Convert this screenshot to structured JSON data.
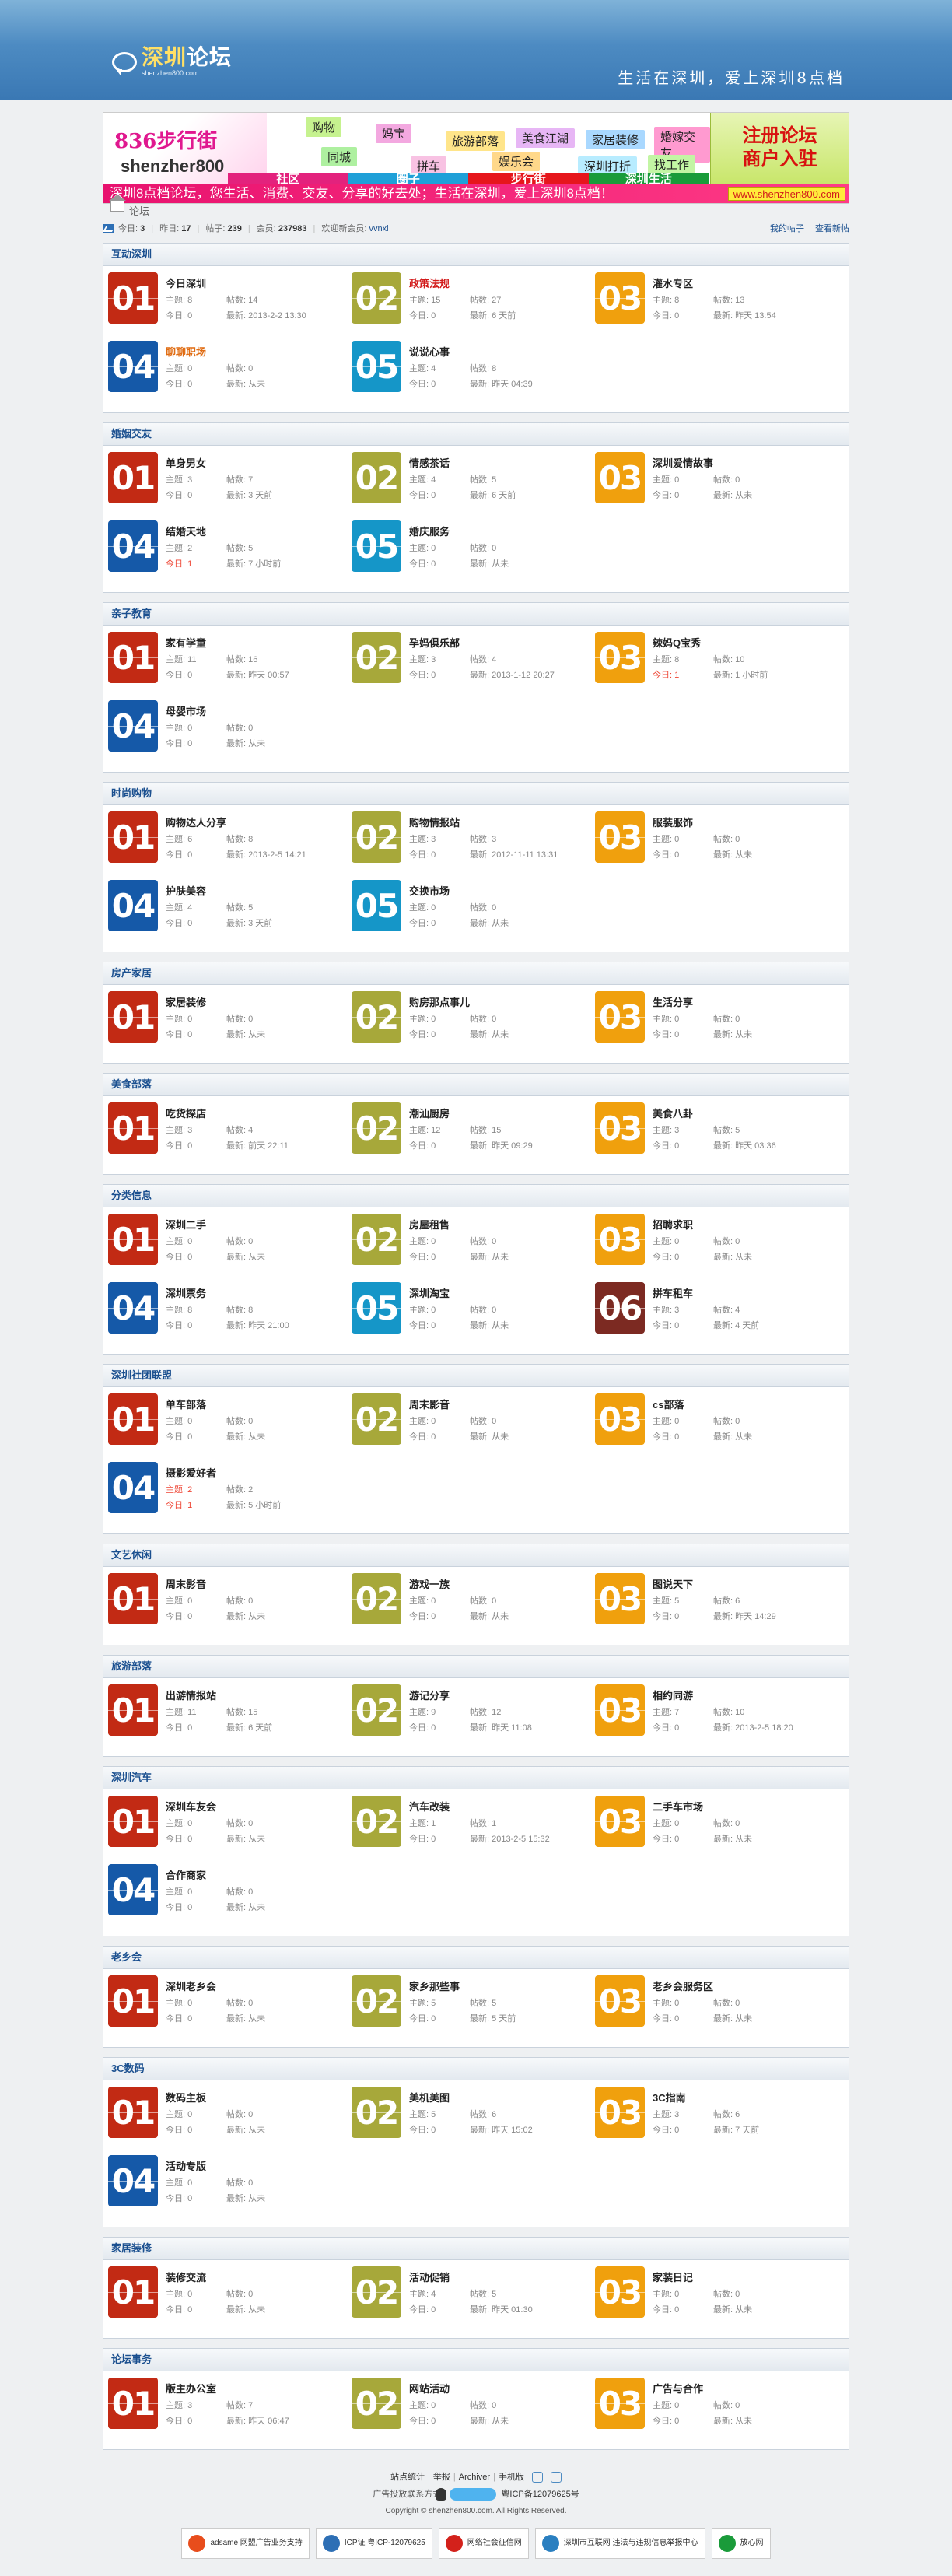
{
  "header": {
    "logo_title_a": "深圳",
    "logo_title_b": "论坛",
    "logo_url": "shenzhen800.com",
    "slogan": "生活在深圳，爱上深圳8点档"
  },
  "banner": {
    "logo_a": "836步行街",
    "logo_b": "shenzher800",
    "tags": [
      "购物",
      "妈宝",
      "旅游部落",
      "美食江湖",
      "家居装修",
      "婚嫁交友",
      "租房",
      "同城",
      "拼车",
      "娱乐会",
      "深圳打折",
      "找工作"
    ],
    "bar": [
      "社区",
      "圈子",
      "步行街",
      "深圳生活"
    ],
    "register": "注册论坛",
    "merchant": "商户入驻",
    "scroll": "深圳8点档论坛，您生活、消费、交友、分享的好去处；生活在深圳，爱上深圳8点档！",
    "url": "www.shenzhen800.com"
  },
  "crumb": "论坛",
  "stats": {
    "today_label": "今日:",
    "today": "3",
    "yesterday_label": "昨日:",
    "yesterday": "17",
    "posts_label": "帖子:",
    "posts": "239",
    "members_label": "会员:",
    "members": "237983",
    "welcome_label": "欢迎新会员:",
    "welcome": "vvnxi",
    "my_posts": "我的帖子",
    "new_posts": "查看新帖"
  },
  "sections": [
    {
      "title": "互动深圳",
      "forums": [
        {
          "num": "01",
          "name": "今日深圳",
          "s": "8",
          "p": "14",
          "t": "0",
          "l": "2013-2-2 13:30"
        },
        {
          "num": "02",
          "name": "政策法规",
          "s": "15",
          "p": "27",
          "t": "0",
          "l": "6 天前",
          "hot": 1
        },
        {
          "num": "03",
          "name": "灌水专区",
          "s": "8",
          "p": "13",
          "t": "0",
          "l": "昨天 13:54"
        },
        {
          "num": "04",
          "name": "聊聊职场",
          "s": "0",
          "p": "0",
          "t": "0",
          "l": "从未",
          "hot": 2
        },
        {
          "num": "05",
          "name": "说说心事",
          "s": "4",
          "p": "8",
          "t": "0",
          "l": "昨天 04:39"
        }
      ]
    },
    {
      "title": "婚姻交友",
      "forums": [
        {
          "num": "01",
          "name": "单身男女",
          "s": "3",
          "p": "7",
          "t": "0",
          "l": "3 天前"
        },
        {
          "num": "02",
          "name": "情感茶话",
          "s": "4",
          "p": "5",
          "t": "0",
          "l": "6 天前"
        },
        {
          "num": "03",
          "name": "深圳爱情故事",
          "s": "0",
          "p": "0",
          "t": "0",
          "l": "从未"
        },
        {
          "num": "04",
          "name": "结婚天地",
          "s": "2",
          "p": "5",
          "t": "1",
          "l": "7 小时前",
          "tr": 1
        },
        {
          "num": "05",
          "name": "婚庆服务",
          "s": "0",
          "p": "0",
          "t": "0",
          "l": "从未"
        }
      ]
    },
    {
      "title": "亲子教育",
      "forums": [
        {
          "num": "01",
          "name": "家有学童",
          "s": "11",
          "p": "16",
          "t": "0",
          "l": "昨天 00:57"
        },
        {
          "num": "02",
          "name": "孕妈俱乐部",
          "s": "3",
          "p": "4",
          "t": "0",
          "l": "2013-1-12 20:27"
        },
        {
          "num": "03",
          "name": "辣妈Q宝秀",
          "s": "8",
          "p": "10",
          "t": "1",
          "l": "1 小时前",
          "tr": 1
        },
        {
          "num": "04",
          "name": "母婴市场",
          "s": "0",
          "p": "0",
          "t": "0",
          "l": "从未"
        }
      ]
    },
    {
      "title": "时尚购物",
      "forums": [
        {
          "num": "01",
          "name": "购物达人分享",
          "s": "6",
          "p": "8",
          "t": "0",
          "l": "2013-2-5 14:21"
        },
        {
          "num": "02",
          "name": "购物情报站",
          "s": "3",
          "p": "3",
          "t": "0",
          "l": "2012-11-11 13:31"
        },
        {
          "num": "03",
          "name": "服装服饰",
          "s": "0",
          "p": "0",
          "t": "0",
          "l": "从未"
        },
        {
          "num": "04",
          "name": "护肤美容",
          "s": "4",
          "p": "5",
          "t": "0",
          "l": "3 天前"
        },
        {
          "num": "05",
          "name": "交换市场",
          "s": "0",
          "p": "0",
          "t": "0",
          "l": "从未"
        }
      ]
    },
    {
      "title": "房产家居",
      "forums": [
        {
          "num": "01",
          "name": "家居装修",
          "s": "0",
          "p": "0",
          "t": "0",
          "l": "从未"
        },
        {
          "num": "02",
          "name": "购房那点事儿",
          "s": "0",
          "p": "0",
          "t": "0",
          "l": "从未"
        },
        {
          "num": "03",
          "name": "生活分享",
          "s": "0",
          "p": "0",
          "t": "0",
          "l": "从未"
        }
      ]
    },
    {
      "title": "美食部落",
      "forums": [
        {
          "num": "01",
          "name": "吃货探店",
          "s": "3",
          "p": "4",
          "t": "0",
          "l": "前天 22:11"
        },
        {
          "num": "02",
          "name": "潮汕厨房",
          "s": "12",
          "p": "15",
          "t": "0",
          "l": "昨天 09:29"
        },
        {
          "num": "03",
          "name": "美食八卦",
          "s": "3",
          "p": "5",
          "t": "0",
          "l": "昨天 03:36"
        }
      ]
    },
    {
      "title": "分类信息",
      "forums": [
        {
          "num": "01",
          "name": "深圳二手",
          "s": "0",
          "p": "0",
          "t": "0",
          "l": "从未"
        },
        {
          "num": "02",
          "name": "房屋租售",
          "s": "0",
          "p": "0",
          "t": "0",
          "l": "从未"
        },
        {
          "num": "03",
          "name": "招聘求职",
          "s": "0",
          "p": "0",
          "t": "0",
          "l": "从未"
        },
        {
          "num": "04",
          "name": "深圳票务",
          "s": "8",
          "p": "8",
          "t": "0",
          "l": "昨天 21:00"
        },
        {
          "num": "05",
          "name": "深圳淘宝",
          "s": "0",
          "p": "0",
          "t": "0",
          "l": "从未"
        },
        {
          "num": "06",
          "name": "拼车租车",
          "s": "3",
          "p": "4",
          "t": "0",
          "l": "4 天前"
        }
      ]
    },
    {
      "title": "深圳社团联盟",
      "forums": [
        {
          "num": "01",
          "name": "单车部落",
          "s": "0",
          "p": "0",
          "t": "0",
          "l": "从未"
        },
        {
          "num": "02",
          "name": "周末影音",
          "s": "0",
          "p": "0",
          "t": "0",
          "l": "从未"
        },
        {
          "num": "03",
          "name": "cs部落",
          "s": "0",
          "p": "0",
          "t": "0",
          "l": "从未"
        },
        {
          "num": "04",
          "name": "摄影爱好者",
          "s": "2",
          "p": "2",
          "t": "1",
          "l": "5 小时前",
          "tr": 1,
          "sr": 1
        }
      ]
    },
    {
      "title": "文艺休闲",
      "forums": [
        {
          "num": "01",
          "name": "周末影音",
          "s": "0",
          "p": "0",
          "t": "0",
          "l": "从未"
        },
        {
          "num": "02",
          "name": "游戏一族",
          "s": "0",
          "p": "0",
          "t": "0",
          "l": "从未"
        },
        {
          "num": "03",
          "name": "图说天下",
          "s": "5",
          "p": "6",
          "t": "0",
          "l": "昨天 14:29"
        }
      ]
    },
    {
      "title": "旅游部落",
      "forums": [
        {
          "num": "01",
          "name": "出游情报站",
          "s": "11",
          "p": "15",
          "t": "0",
          "l": "6 天前"
        },
        {
          "num": "02",
          "name": "游记分享",
          "s": "9",
          "p": "12",
          "t": "0",
          "l": "昨天 11:08"
        },
        {
          "num": "03",
          "name": "相约同游",
          "s": "7",
          "p": "10",
          "t": "0",
          "l": "2013-2-5 18:20"
        }
      ]
    },
    {
      "title": "深圳汽车",
      "forums": [
        {
          "num": "01",
          "name": "深圳车友会",
          "s": "0",
          "p": "0",
          "t": "0",
          "l": "从未"
        },
        {
          "num": "02",
          "name": "汽车改装",
          "s": "1",
          "p": "1",
          "t": "0",
          "l": "2013-2-5 15:32"
        },
        {
          "num": "03",
          "name": "二手车市场",
          "s": "0",
          "p": "0",
          "t": "0",
          "l": "从未"
        },
        {
          "num": "04",
          "name": "合作商家",
          "s": "0",
          "p": "0",
          "t": "0",
          "l": "从未"
        }
      ]
    },
    {
      "title": "老乡会",
      "forums": [
        {
          "num": "01",
          "name": "深圳老乡会",
          "s": "0",
          "p": "0",
          "t": "0",
          "l": "从未"
        },
        {
          "num": "02",
          "name": "家乡那些事",
          "s": "5",
          "p": "5",
          "t": "0",
          "l": "5 天前"
        },
        {
          "num": "03",
          "name": "老乡会服务区",
          "s": "0",
          "p": "0",
          "t": "0",
          "l": "从未"
        }
      ]
    },
    {
      "title": "3C数码",
      "forums": [
        {
          "num": "01",
          "name": "数码主板",
          "s": "0",
          "p": "0",
          "t": "0",
          "l": "从未"
        },
        {
          "num": "02",
          "name": "美机美图",
          "s": "5",
          "p": "6",
          "t": "0",
          "l": "昨天 15:02"
        },
        {
          "num": "03",
          "name": "3C指南",
          "s": "3",
          "p": "6",
          "t": "0",
          "l": "7 天前"
        },
        {
          "num": "04",
          "name": "活动专版",
          "s": "0",
          "p": "0",
          "t": "0",
          "l": "从未"
        }
      ]
    },
    {
      "title": "家居装修",
      "forums": [
        {
          "num": "01",
          "name": "装修交流",
          "s": "0",
          "p": "0",
          "t": "0",
          "l": "从未"
        },
        {
          "num": "02",
          "name": "活动促销",
          "s": "4",
          "p": "5",
          "t": "0",
          "l": "昨天 01:30"
        },
        {
          "num": "03",
          "name": "家装日记",
          "s": "0",
          "p": "0",
          "t": "0",
          "l": "从未"
        }
      ]
    },
    {
      "title": "论坛事务",
      "forums": [
        {
          "num": "01",
          "name": "版主办公室",
          "s": "3",
          "p": "7",
          "t": "0",
          "l": "昨天 06:47"
        },
        {
          "num": "02",
          "name": "网站活动",
          "s": "0",
          "p": "0",
          "t": "0",
          "l": "从未"
        },
        {
          "num": "03",
          "name": "广告与合作",
          "s": "0",
          "p": "0",
          "t": "0",
          "l": "从未"
        }
      ]
    }
  ],
  "labels": {
    "s": "主题:",
    "p": "帖数:",
    "t": "今日:",
    "l": "最新:"
  },
  "footer": {
    "links": [
      "站点统计",
      "举报",
      "Archiver",
      "手机版"
    ],
    "contact": "广告投放联系方式：",
    "icp": "粤ICP备12079625号",
    "copyright": "Copyright © shenzhen800.com. All Rights Reserved.",
    "badges": [
      "adsame 网盟广告业务支持",
      "ICP证 粤ICP-12079625",
      "网络社会征信网",
      "深圳市互联网 违法与违规信息举报中心",
      "放心网"
    ]
  },
  "colors": {
    "red": "#c22a14",
    "olive": "#a7a83a",
    "yellow": "#f0a00d",
    "blue": "#1559a8",
    "cyan": "#1596c8",
    "maroon": "#7c2a22"
  }
}
